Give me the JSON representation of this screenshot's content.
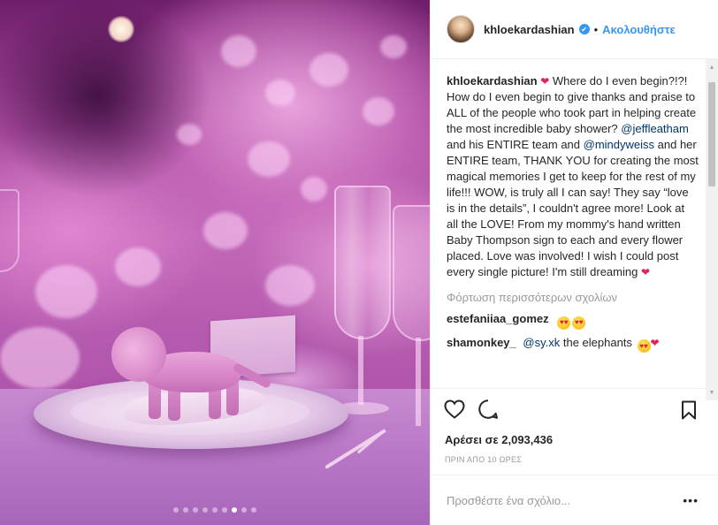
{
  "post": {
    "photo": {
      "carousel_total": 9,
      "carousel_active_index": 6
    },
    "header": {
      "username": "khloekardashian",
      "verified_symbol": "✔",
      "separator": "•",
      "follow_label": "Ακολουθήστε"
    },
    "caption": {
      "username": "khloekardashian",
      "part1": " Where do I even begin?!?! How do I even begin to give thanks and praise to ALL of the people who took part in helping create the most incredible baby shower? ",
      "mention1": "@jeffleatham",
      "part2": " and his ENTIRE team and ",
      "mention2": "@mindyweiss",
      "part3": " and her ENTIRE team, THANK YOU for creating the most magical memories I get to keep for the rest of my life!!! WOW, is truly all I can say! They say “love is in the details”, I couldn't agree more! Look at all the LOVE! From my mommy's hand written Baby Thompson sign to each and every flower placed. Love was involved! I wish I could post every single picture! I'm still dreaming "
    },
    "load_more_label": "Φόρτωση περισσότερων σχολίων",
    "comments": [
      {
        "username": "estefaniiaa_gomez",
        "text": "",
        "mention": ""
      },
      {
        "username": "shamonkey_",
        "mention": "@sy.xk",
        "text": " the elephants "
      }
    ],
    "likes_text": "Αρέσει σε 2,093,436",
    "time_text": "ΠΡΙΝ ΑΠΟ 10 ΩΡΕΣ",
    "add_comment_placeholder": "Προσθέστε ένα σχόλιο...",
    "more_dots": "•••",
    "icons": {
      "like": "heart-outline-icon",
      "comment": "comment-bubble-icon",
      "save": "bookmark-icon",
      "verified": "verified-badge-icon",
      "heart_emoji": "heart-emoji",
      "heart_eyes": "heart-eyes-emoji"
    },
    "colors": {
      "accent_blue": "#3897f0",
      "mention": "#003569",
      "muted": "#999999",
      "heart_emoji": "#e0245e"
    }
  }
}
